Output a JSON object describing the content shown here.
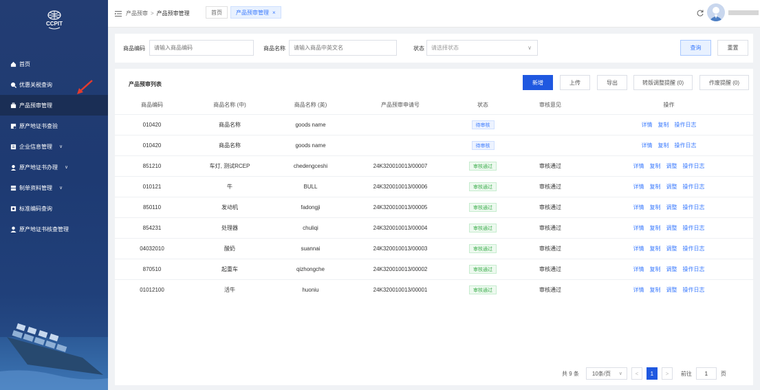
{
  "logo": {
    "text": "CCPIT"
  },
  "sidebar": {
    "items": [
      {
        "label": "首页",
        "icon": "home-icon",
        "chevron": ""
      },
      {
        "label": "优惠关税查询",
        "icon": "search-icon",
        "chevron": ""
      },
      {
        "label": "产品预审管理",
        "icon": "briefcase-icon",
        "chevron": "",
        "active": true
      },
      {
        "label": "原产地证书查验",
        "icon": "certificate-icon",
        "chevron": ""
      },
      {
        "label": "企业信息管理",
        "icon": "building-icon",
        "chevron": "∨"
      },
      {
        "label": "原产地证书办理",
        "icon": "user-search-icon",
        "chevron": "∨"
      },
      {
        "label": "制单资料管理",
        "icon": "document-stack-icon",
        "chevron": "∨"
      },
      {
        "label": "标准编码查询",
        "icon": "code-icon",
        "chevron": ""
      },
      {
        "label": "原产地证书核查管理",
        "icon": "user-icon",
        "chevron": ""
      }
    ]
  },
  "topbar": {
    "breadcrumb": {
      "parent": "产品预审",
      "separator": ">",
      "current": "产品预审管理"
    },
    "tabs": [
      {
        "label": "首页",
        "active": false
      },
      {
        "label": "产品预审管理",
        "active": true,
        "close": "×"
      }
    ]
  },
  "search": {
    "code_label": "商品编码",
    "code_placeholder": "请输入商品编码",
    "name_label": "商品名称",
    "name_placeholder": "请输入商品中英文名",
    "status_label": "状态",
    "status_placeholder": "请选择状态",
    "status_caret": "∨",
    "query_label": "查询",
    "reset_label": "重置"
  },
  "list": {
    "title": "产品预审列表",
    "toolbar": {
      "add": "新增",
      "upload": "上传",
      "export": "导出",
      "transfer_remind": "转版调整提醒 (0)",
      "void_remind": "作废提醒 (0)"
    },
    "columns": [
      "商品编码",
      "商品名称 (中)",
      "商品名称 (英)",
      "产品预审申请号",
      "状态",
      "审核意见",
      "操作"
    ],
    "rows": [
      {
        "code": "010420",
        "name_cn": "商品名称",
        "name_en": "goods name",
        "app_no": "",
        "status": "待审核",
        "status_type": "pending",
        "opinion": "",
        "ops": [
          "详情",
          "复制",
          "操作日志"
        ]
      },
      {
        "code": "010420",
        "name_cn": "商品名称",
        "name_en": "goods name",
        "app_no": "",
        "status": "待审核",
        "status_type": "pending",
        "opinion": "",
        "ops": [
          "详情",
          "复制",
          "操作日志"
        ]
      },
      {
        "code": "851210",
        "name_cn": "车灯, 测试RCEP",
        "name_en": "chedengceshi",
        "app_no": "24K320010013/00007",
        "status": "审核通过",
        "status_type": "pass",
        "opinion": "审核通过",
        "ops": [
          "详情",
          "复制",
          "调整",
          "操作日志"
        ]
      },
      {
        "code": "010121",
        "name_cn": "牛",
        "name_en": "BULL",
        "app_no": "24K320010013/00006",
        "status": "审核通过",
        "status_type": "pass",
        "opinion": "审核通过",
        "ops": [
          "详情",
          "复制",
          "调整",
          "操作日志"
        ]
      },
      {
        "code": "850110",
        "name_cn": "发动机",
        "name_en": "fadongji",
        "app_no": "24K320010013/00005",
        "status": "审核通过",
        "status_type": "pass",
        "opinion": "审核通过",
        "ops": [
          "详情",
          "复制",
          "调整",
          "操作日志"
        ]
      },
      {
        "code": "854231",
        "name_cn": "处理器",
        "name_en": "chuliqi",
        "app_no": "24K320010013/00004",
        "status": "审核通过",
        "status_type": "pass",
        "opinion": "审核通过",
        "ops": [
          "详情",
          "复制",
          "调整",
          "操作日志"
        ]
      },
      {
        "code": "04032010",
        "name_cn": "酸奶",
        "name_en": "suannai",
        "app_no": "24K320010013/00003",
        "status": "审核通过",
        "status_type": "pass",
        "opinion": "审核通过",
        "ops": [
          "详情",
          "复制",
          "调整",
          "操作日志"
        ]
      },
      {
        "code": "870510",
        "name_cn": "起重车",
        "name_en": "qizhongche",
        "app_no": "24K320010013/00002",
        "status": "审核通过",
        "status_type": "pass",
        "opinion": "审核通过",
        "ops": [
          "详情",
          "复制",
          "调整",
          "操作日志"
        ]
      },
      {
        "code": "01012100",
        "name_cn": "活牛",
        "name_en": "huoniu",
        "app_no": "24K320010013/00001",
        "status": "审核通过",
        "status_type": "pass",
        "opinion": "审核通过",
        "ops": [
          "详情",
          "复制",
          "调整",
          "操作日志"
        ]
      }
    ]
  },
  "pagination": {
    "total": "共 9 条",
    "page_size": "10条/页",
    "caret": "∨",
    "prev": "<",
    "current_page": "1",
    "next": ">",
    "goto_label": "前往",
    "goto_value": "1",
    "page_unit": "页"
  },
  "colors": {
    "sidebar_bg": "#233d73",
    "primary": "#1f58e0",
    "link": "#3a7afe",
    "pass_green": "#3eaf4e"
  }
}
